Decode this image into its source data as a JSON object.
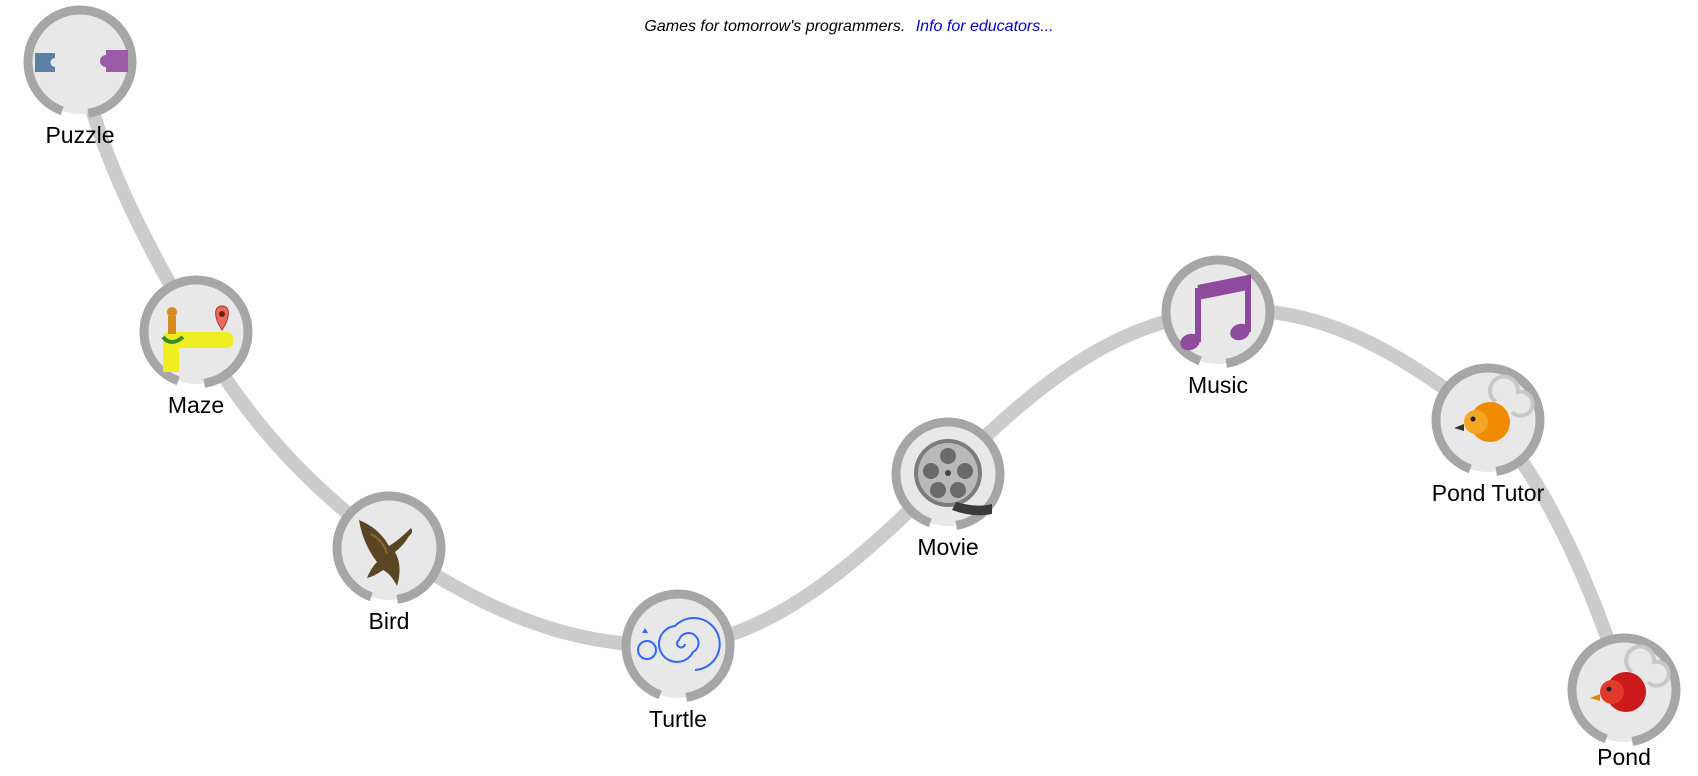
{
  "header": {
    "tagline": "Games for tomorrow's programmers.",
    "educators_link": "Info for educators..."
  },
  "games": [
    {
      "id": "puzzle",
      "label": "Puzzle",
      "icon": "puzzle-icon"
    },
    {
      "id": "maze",
      "label": "Maze",
      "icon": "maze-icon"
    },
    {
      "id": "bird",
      "label": "Bird",
      "icon": "bird-icon"
    },
    {
      "id": "turtle",
      "label": "Turtle",
      "icon": "turtle-spiral-icon"
    },
    {
      "id": "movie",
      "label": "Movie",
      "icon": "film-reel-icon"
    },
    {
      "id": "music",
      "label": "Music",
      "icon": "music-note-icon"
    },
    {
      "id": "pond-tutor",
      "label": "Pond Tutor",
      "icon": "orange-duck-icon"
    },
    {
      "id": "pond",
      "label": "Pond",
      "icon": "red-duck-icon"
    }
  ],
  "colors": {
    "path": "#cccccc",
    "ring": "#a6a6a6",
    "disc": "#e8e8e8",
    "link": "#0000dd"
  }
}
